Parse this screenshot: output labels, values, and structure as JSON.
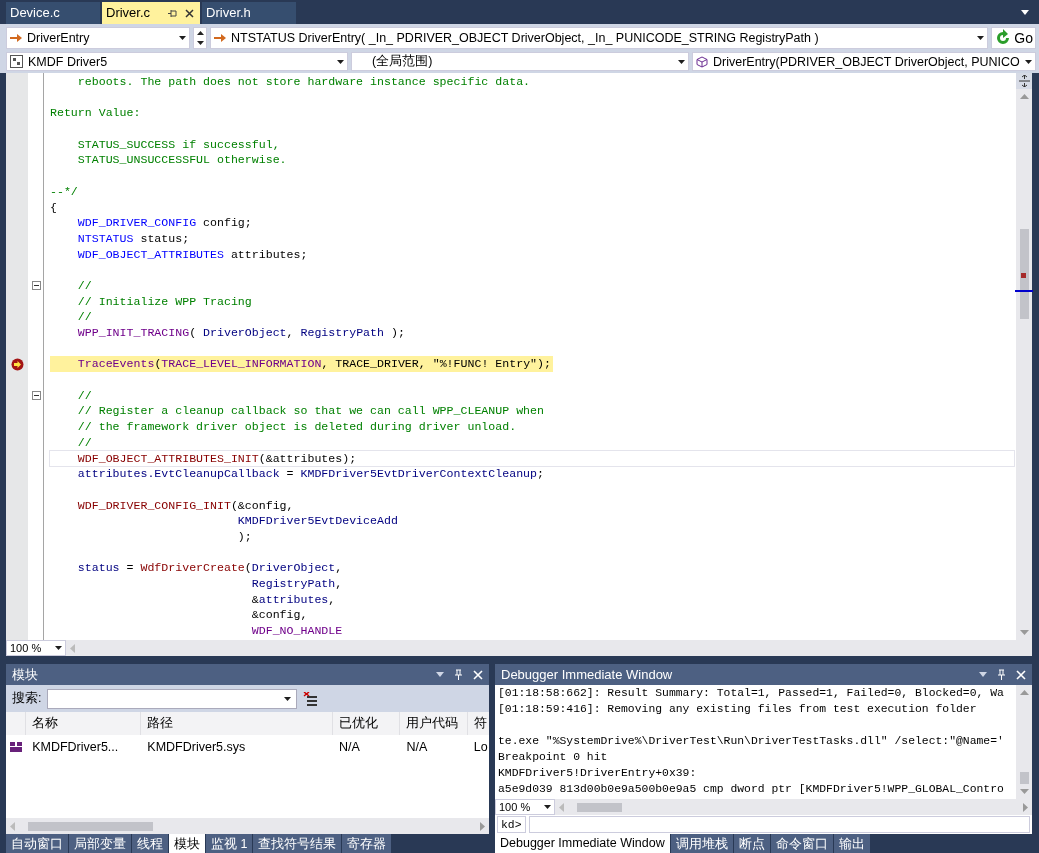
{
  "doc_tabs": [
    {
      "label": "Device.c",
      "selected": false
    },
    {
      "label": "Driver.c",
      "selected": true
    },
    {
      "label": "Driver.h",
      "selected": false
    }
  ],
  "nav": {
    "function": "DriverEntry",
    "signature": "NTSTATUS DriverEntry( _In_ PDRIVER_OBJECT DriverObject, _In_ PUNICODE_STRING RegistryPath )",
    "go": "Go",
    "project": "KMDF Driver5",
    "scope": "(全局范围)",
    "member": "DriverEntry(PDRIVER_OBJECT DriverObject, PUNICO"
  },
  "editor": {
    "zoom": "100 %",
    "lines": [
      {
        "kind": "normal",
        "fold": false,
        "tokens": [
          {
            "kind": "comment",
            "text": "    reboots. The path does not store hardware instance specific data."
          }
        ]
      },
      {
        "kind": "normal",
        "fold": false
      },
      {
        "kind": "normal",
        "fold": false,
        "tokens": [
          {
            "kind": "comment",
            "text": "Return Value:"
          }
        ]
      },
      {
        "kind": "normal",
        "fold": false
      },
      {
        "kind": "normal",
        "fold": false,
        "tokens": [
          {
            "kind": "comment",
            "text": "    STATUS_SUCCESS if successful,"
          }
        ]
      },
      {
        "kind": "normal",
        "fold": false,
        "tokens": [
          {
            "kind": "comment",
            "text": "    STATUS_UNSUCCESSFUL otherwise."
          }
        ]
      },
      {
        "kind": "normal",
        "fold": false
      },
      {
        "kind": "normal",
        "fold": false,
        "tokens": [
          {
            "kind": "comment",
            "text": "--*/"
          }
        ]
      },
      {
        "kind": "normal",
        "fold": false,
        "tokens": [
          {
            "kind": "text",
            "text": "{"
          }
        ]
      },
      {
        "kind": "normal",
        "fold": false,
        "tokens": [
          {
            "kind": "type",
            "text": "    WDF_DRIVER_CONFIG"
          },
          {
            "kind": "text",
            "text": " config;"
          }
        ]
      },
      {
        "kind": "normal",
        "fold": false,
        "tokens": [
          {
            "kind": "type",
            "text": "    NTSTATUS"
          },
          {
            "kind": "text",
            "text": " status;"
          }
        ]
      },
      {
        "kind": "normal",
        "fold": false,
        "tokens": [
          {
            "kind": "type",
            "text": "    WDF_OBJECT_ATTRIBUTES"
          },
          {
            "kind": "text",
            "text": " attributes;"
          }
        ]
      },
      {
        "kind": "normal",
        "fold": false
      },
      {
        "kind": "normal",
        "fold": true,
        "tokens": [
          {
            "kind": "comment",
            "text": "    //"
          }
        ]
      },
      {
        "kind": "normal",
        "fold": false,
        "tokens": [
          {
            "kind": "comment",
            "text": "    // Initialize WPP Tracing"
          }
        ]
      },
      {
        "kind": "normal",
        "fold": false,
        "tokens": [
          {
            "kind": "comment",
            "text": "    //"
          }
        ]
      },
      {
        "kind": "normal",
        "fold": false,
        "tokens": [
          {
            "kind": "macro",
            "text": "    WPP_INIT_TRACING"
          },
          {
            "kind": "text",
            "text": "( "
          },
          {
            "kind": "ident",
            "text": "DriverObject"
          },
          {
            "kind": "text",
            "text": ", "
          },
          {
            "kind": "ident",
            "text": "RegistryPath"
          },
          {
            "kind": "text",
            "text": " );"
          }
        ]
      },
      {
        "kind": "normal",
        "fold": false
      },
      {
        "kind": "current",
        "fold": false,
        "tokens": [
          {
            "kind": "macro",
            "text": "    TraceEvents"
          },
          {
            "kind": "text",
            "text": "("
          },
          {
            "kind": "macro",
            "text": "TRACE_LEVEL_INFORMATION"
          },
          {
            "kind": "text",
            "text": ", TRACE_DRIVER, \"%!FUNC! Entry\");"
          }
        ]
      },
      {
        "kind": "normal",
        "fold": false
      },
      {
        "kind": "normal",
        "fold": true,
        "tokens": [
          {
            "kind": "comment",
            "text": "    //"
          }
        ]
      },
      {
        "kind": "normal",
        "fold": false,
        "tokens": [
          {
            "kind": "comment",
            "text": "    // Register a cleanup callback so that we can call WPP_CLEANUP when"
          }
        ]
      },
      {
        "kind": "normal",
        "fold": false,
        "tokens": [
          {
            "kind": "comment",
            "text": "    // the framework driver object is deleted during driver unload."
          }
        ]
      },
      {
        "kind": "normal",
        "fold": false,
        "tokens": [
          {
            "kind": "comment",
            "text": "    //"
          }
        ]
      },
      {
        "kind": "caret",
        "fold": false,
        "tokens": [
          {
            "kind": "func",
            "text": "    WDF_OBJECT_ATTRIBUTES_INIT"
          },
          {
            "kind": "text",
            "text": "(&attributes);"
          }
        ]
      },
      {
        "kind": "normal",
        "fold": false,
        "tokens": [
          {
            "kind": "ident",
            "text": "    attributes.EvtCleanupCallback"
          },
          {
            "kind": "text",
            "text": " = "
          },
          {
            "kind": "ident",
            "text": "KMDFDriver5EvtDriverContextCleanup"
          },
          {
            "kind": "text",
            "text": ";"
          }
        ]
      },
      {
        "kind": "normal",
        "fold": false
      },
      {
        "kind": "normal",
        "fold": false,
        "tokens": [
          {
            "kind": "func",
            "text": "    WDF_DRIVER_CONFIG_INIT"
          },
          {
            "kind": "text",
            "text": "(&config,"
          }
        ]
      },
      {
        "kind": "normal",
        "fold": false,
        "tokens": [
          {
            "kind": "ident",
            "text": "                           KMDFDriver5EvtDeviceAdd"
          }
        ]
      },
      {
        "kind": "normal",
        "fold": false,
        "tokens": [
          {
            "kind": "text",
            "text": "                           );"
          }
        ]
      },
      {
        "kind": "normal",
        "fold": false
      },
      {
        "kind": "normal",
        "fold": false,
        "tokens": [
          {
            "kind": "ident",
            "text": "    status"
          },
          {
            "kind": "text",
            "text": " = "
          },
          {
            "kind": "func",
            "text": "WdfDriverCreate"
          },
          {
            "kind": "text",
            "text": "("
          },
          {
            "kind": "ident",
            "text": "DriverObject"
          },
          {
            "kind": "text",
            "text": ","
          }
        ]
      },
      {
        "kind": "normal",
        "fold": false,
        "tokens": [
          {
            "kind": "ident",
            "text": "                             RegistryPath"
          },
          {
            "kind": "text",
            "text": ","
          }
        ]
      },
      {
        "kind": "normal",
        "fold": false,
        "tokens": [
          {
            "kind": "text",
            "text": "                             &"
          },
          {
            "kind": "ident",
            "text": "attributes"
          },
          {
            "kind": "text",
            "text": ","
          }
        ]
      },
      {
        "kind": "normal",
        "fold": false,
        "tokens": [
          {
            "kind": "text",
            "text": "                             &config,"
          }
        ]
      },
      {
        "kind": "normal",
        "fold": false,
        "tokens": [
          {
            "kind": "macro",
            "text": "                             WDF_NO_HANDLE"
          }
        ]
      }
    ]
  },
  "modules_panel": {
    "title": "模块",
    "search_label": "搜索:",
    "columns": [
      "名称",
      "路径",
      "已优化",
      "用户代码",
      "符"
    ],
    "rows": [
      {
        "cells": [
          "KMDFDriver5...",
          "KMDFDriver5.sys",
          "N/A",
          "N/A",
          "Lo"
        ]
      }
    ],
    "tabs": [
      {
        "label": "自动窗口",
        "selected": false
      },
      {
        "label": "局部变量",
        "selected": false
      },
      {
        "label": "线程",
        "selected": false
      },
      {
        "label": "模块",
        "selected": true
      },
      {
        "label": "监视 1",
        "selected": false
      },
      {
        "label": "查找符号结果",
        "selected": false
      },
      {
        "label": "寄存器",
        "selected": false
      }
    ]
  },
  "immediate_panel": {
    "title": "Debugger Immediate Window",
    "blocks": [
      [
        "[01:18:58:662]: Result Summary: Total=1, Passed=1, Failed=0, Blocked=0, Wa",
        "[01:18:59:416]: Removing any existing files from test execution folder"
      ],
      [
        "te.exe \"%SystemDrive%\\DriverTest\\Run\\DriverTestTasks.dll\" /select:\"@Name='",
        "Breakpoint 0 hit",
        "KMDFDriver5!DriverEntry+0x39:",
        "a5e9d039 813d00b0e9a500b0e9a5 cmp dword ptr [KMDFDriver5!WPP_GLOBAL_Contro"
      ]
    ],
    "zoom": "100 %",
    "prompt": "kd>",
    "tabs": [
      {
        "label": "Debugger Immediate Window",
        "selected": true
      },
      {
        "label": "调用堆栈",
        "selected": false
      },
      {
        "label": "断点",
        "selected": false
      },
      {
        "label": "命令窗口",
        "selected": false
      },
      {
        "label": "输出",
        "selected": false
      }
    ]
  }
}
